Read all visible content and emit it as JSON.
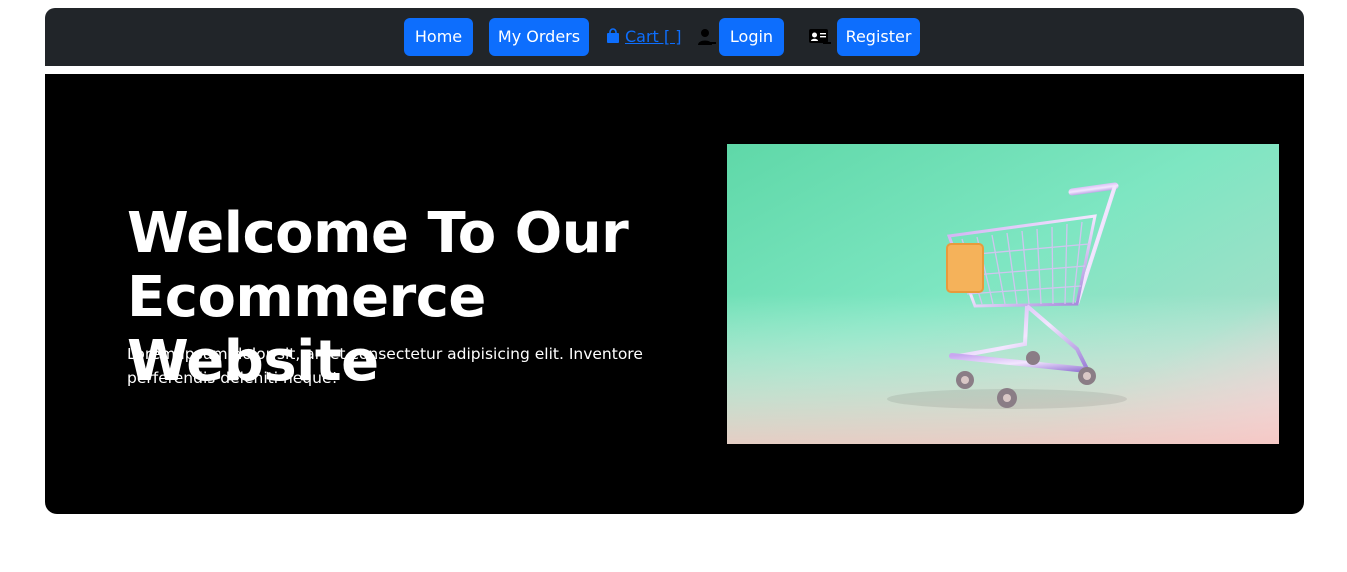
{
  "nav": {
    "home_label": "Home",
    "orders_label": "My Orders",
    "cart_label": "Cart [ ]",
    "login_label": "Login",
    "register_label": "Register"
  },
  "hero": {
    "title": "Welcome To Our Ecommerce Website",
    "description": "Lorem ipsum dolor sit, amet consectetur adipisicing elit. Inventore perferendis deleniti neque!",
    "image_icon": "shopping-cart-image"
  },
  "colors": {
    "navbar_bg": "#212529",
    "primary": "#0d6efd",
    "hero_bg": "#000000"
  }
}
